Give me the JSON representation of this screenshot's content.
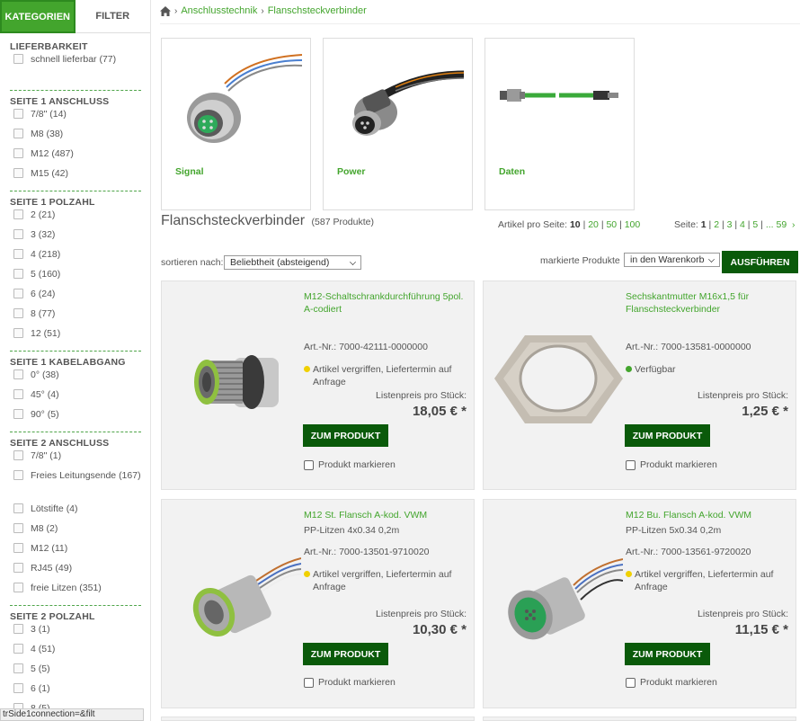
{
  "sidebar": {
    "tab_categories": "KATEGORIEN",
    "tab_filter": "FILTER",
    "groups": [
      {
        "title": "LIEFERBARKEIT",
        "options": [
          "schnell lieferbar (77)"
        ]
      },
      {
        "title": "SEITE 1 ANSCHLUSS",
        "options": [
          "7/8\" (14)",
          "M8 (38)",
          "M12 (487)",
          "M15 (42)"
        ]
      },
      {
        "title": "SEITE 1 POLZAHL",
        "options": [
          "2 (21)",
          "3 (32)",
          "4 (218)",
          "5 (160)",
          "6 (24)",
          "8 (77)",
          "12 (51)"
        ]
      },
      {
        "title": "SEITE 1 KABELABGANG",
        "options": [
          "0° (38)",
          "45° (4)",
          "90° (5)"
        ]
      },
      {
        "title": "SEITE 2 ANSCHLUSS",
        "options": [
          "7/8\" (1)",
          "Freies Leitungsende (167)",
          "Lötstifte (4)",
          "M8 (2)",
          "M12 (11)",
          "RJ45 (49)",
          "freie Litzen (351)"
        ]
      },
      {
        "title": "SEITE 2 POLZAHL",
        "options": [
          "3 (1)",
          "4 (51)",
          "5 (5)",
          "6 (1)",
          "8 (5)"
        ]
      }
    ],
    "status_url": "trSide1connection=&filt"
  },
  "breadcrumb": {
    "items": [
      "Anschlusstechnik",
      "Flanschsteckverbinder"
    ]
  },
  "categories": [
    {
      "label": "Signal",
      "icon": "signal-connector"
    },
    {
      "label": "Power",
      "icon": "power-connector"
    },
    {
      "label": "Daten",
      "icon": "data-cable"
    }
  ],
  "listing": {
    "title": "Flanschsteckverbinder",
    "count": "(587 Produkte)",
    "per_page_label": "Artikel pro Seite:",
    "per_page_current": "10",
    "per_page_options": [
      "20",
      "50",
      "100"
    ],
    "pages_label": "Seite:",
    "page_current": "1",
    "pages": [
      "2",
      "3",
      "4",
      "5"
    ],
    "pages_ellipsis": "... 59",
    "sort_label": "sortieren nach:",
    "sort_value": "Beliebtheit (absteigend)",
    "mark_label": "markierte Produkte",
    "mark_value": "in den Warenkorb",
    "exec_button": "AUSFÜHREN"
  },
  "products": [
    {
      "name": "M12-Schaltschrankdurchführung 5pol. A-codiert",
      "desc": "",
      "artnr": "Art.-Nr.: 7000-42111-0000000",
      "availability": "Artikel vergriffen, Liefertermin auf Anfrage",
      "status_color": "#f0d000",
      "price_label": "Listenpreis pro Stück:",
      "price": "18,05 € *",
      "button": "ZUM PRODUKT",
      "mark": "Produkt markieren"
    },
    {
      "name": "Sechskantmutter M16x1,5 für Flanschsteckverbinder",
      "desc": "",
      "artnr": "Art.-Nr.: 7000-13581-0000000",
      "availability": "Verfügbar",
      "status_color": "#43a52d",
      "price_label": "Listenpreis pro Stück:",
      "price": "1,25 € *",
      "button": "ZUM PRODUKT",
      "mark": "Produkt markieren"
    },
    {
      "name": "M12 St. Flansch A-kod. VWM",
      "desc": "PP-Litzen 4x0.34 0,2m",
      "artnr": "Art.-Nr.: 7000-13501-9710020",
      "availability": "Artikel vergriffen, Liefertermin auf Anfrage",
      "status_color": "#f0d000",
      "price_label": "Listenpreis pro Stück:",
      "price": "10,30 € *",
      "button": "ZUM PRODUKT",
      "mark": "Produkt markieren"
    },
    {
      "name": "M12 Bu. Flansch A-kod. VWM",
      "desc": "PP-Litzen 5x0.34 0,2m",
      "artnr": "Art.-Nr.: 7000-13561-9720020",
      "availability": "Artikel vergriffen, Liefertermin auf Anfrage",
      "status_color": "#f0d000",
      "price_label": "Listenpreis pro Stück:",
      "price": "11,15 € *",
      "button": "ZUM PRODUKT",
      "mark": "Produkt markieren"
    }
  ],
  "colors": {
    "accent": "#43a52d",
    "button": "#0a5a0a"
  }
}
